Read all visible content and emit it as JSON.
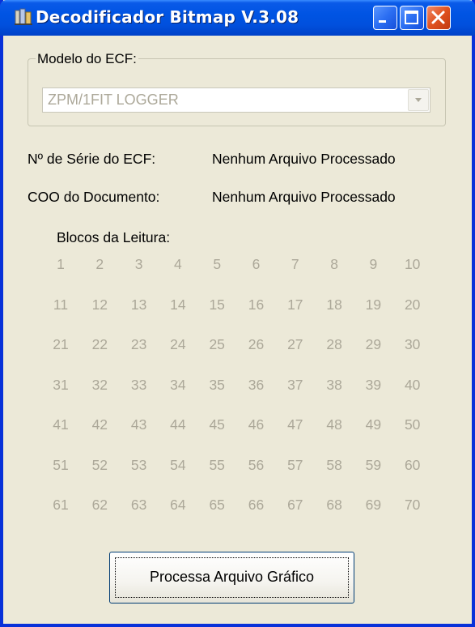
{
  "window": {
    "title": "Decodificador Bitmap V.3.08"
  },
  "titlebar_buttons": {
    "minimize_icon": "minimize-icon",
    "maximize_icon": "maximize-icon",
    "close_icon": "close-icon"
  },
  "modelo": {
    "legend": "Modelo do ECF:",
    "selected": "ZPM/1FIT LOGGER"
  },
  "serie": {
    "label": "Nº de Série do ECF:",
    "value": "Nenhum Arquivo Processado"
  },
  "coo": {
    "label": "COO do Documento:",
    "value": "Nenhum Arquivo Processado"
  },
  "blocos": {
    "label": "Blocos da Leitura:",
    "rows": [
      [
        "1",
        "2",
        "3",
        "4",
        "5",
        "6",
        "7",
        "8",
        "9",
        "10"
      ],
      [
        "11",
        "12",
        "13",
        "14",
        "15",
        "16",
        "17",
        "18",
        "19",
        "20"
      ],
      [
        "21",
        "22",
        "23",
        "24",
        "25",
        "26",
        "27",
        "28",
        "29",
        "30"
      ],
      [
        "31",
        "32",
        "33",
        "34",
        "35",
        "36",
        "37",
        "38",
        "39",
        "40"
      ],
      [
        "41",
        "42",
        "43",
        "44",
        "45",
        "46",
        "47",
        "48",
        "49",
        "50"
      ],
      [
        "51",
        "52",
        "53",
        "54",
        "55",
        "56",
        "57",
        "58",
        "59",
        "60"
      ],
      [
        "61",
        "62",
        "63",
        "64",
        "65",
        "66",
        "67",
        "68",
        "69",
        "70"
      ]
    ]
  },
  "actions": {
    "process_label": "Processa Arquivo Gráfico"
  },
  "colors": {
    "titlebar": "#0054e3",
    "window_bg": "#ece9d8",
    "disabled_text": "#aca899",
    "close_button": "#e0521f"
  }
}
